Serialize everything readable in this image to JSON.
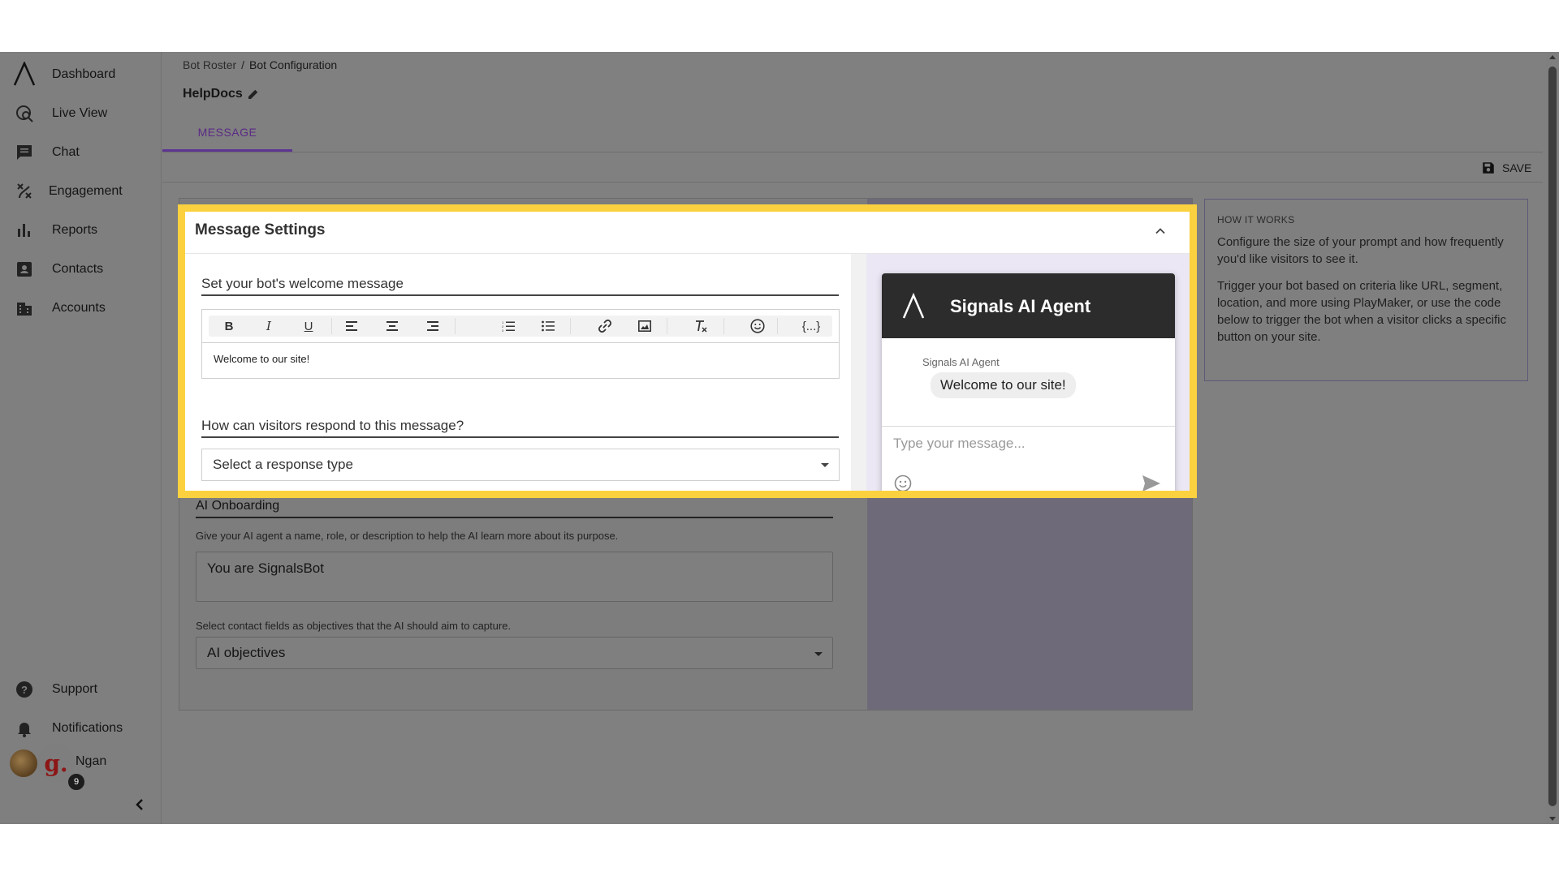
{
  "sidebar": {
    "logo_icon": "signals-logo-icon",
    "items": [
      {
        "label": "Dashboard",
        "icon": "dashboard-icon"
      },
      {
        "label": "Live View",
        "icon": "live-view-icon"
      },
      {
        "label": "Chat",
        "icon": "chat-icon"
      },
      {
        "label": "Engagement",
        "icon": "engagement-icon"
      },
      {
        "label": "Reports",
        "icon": "reports-icon"
      },
      {
        "label": "Contacts",
        "icon": "contacts-icon"
      },
      {
        "label": "Accounts",
        "icon": "accounts-icon"
      }
    ],
    "support_label": "Support",
    "notifications_label": "Notifications",
    "user": {
      "avatar_letter": "g.",
      "badge_count": "9",
      "name": "Ngan"
    }
  },
  "header": {
    "breadcrumb": {
      "parent": "Bot Roster",
      "separator": "/",
      "current": "Bot Configuration"
    },
    "bot_name": "HelpDocs",
    "tab": "MESSAGE",
    "save_label": "SAVE"
  },
  "message_settings": {
    "title": "Message Settings",
    "welcome_label": "Set your bot's welcome message",
    "welcome_value": "Welcome to our site!",
    "toolbar": {
      "bold": "B",
      "italic": "I",
      "underline": "U",
      "variable": "{...}"
    },
    "respond_label": "How can visitors respond to this message?",
    "response_select": "Select a response type"
  },
  "ai_onboarding": {
    "title": "AI Onboarding",
    "help": "Give your AI agent a name, role, or description to help the AI learn more about its purpose.",
    "prompt_value": "You are SignalsBot",
    "objectives_help": "Select contact fields as objectives that the AI should aim to capture.",
    "objectives_select": "AI objectives"
  },
  "chat_preview": {
    "title": "Signals AI Agent",
    "sender": "Signals AI Agent",
    "message": "Welcome to our site!",
    "input_placeholder": "Type your message..."
  },
  "how_it_works": {
    "heading": "HOW IT WORKS",
    "p1": "Configure the size of your prompt and how frequently you'd like visitors to see it.",
    "p2": "Trigger your bot based on criteria like URL, segment, location, and more using PlayMaker, or use the code below to trigger the bot when a visitor clicks a specific button on your site."
  },
  "colors": {
    "highlight": "#fbd13f",
    "accent": "#5d3592",
    "chat_header": "#2c2c2c"
  }
}
